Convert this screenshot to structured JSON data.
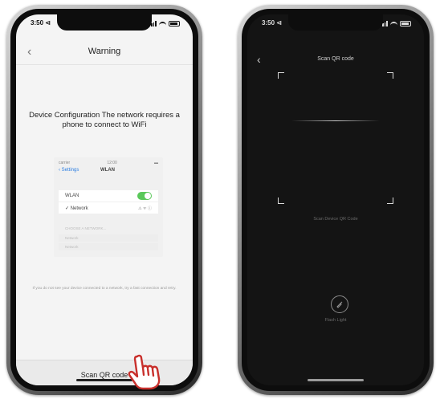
{
  "left_phone": {
    "status": {
      "time": "3:50 ⊲"
    },
    "nav": {
      "back": "‹",
      "title": "Warning"
    },
    "message": "Device Configuration The network requires a phone to connect to WiFi",
    "wifi_settings": {
      "mini_status_left": "carrier",
      "mini_status_time": "12:00",
      "back_label": "‹ Settings",
      "title": "WLAN",
      "wlan_label": "WLAN",
      "network_label": "✓ Network",
      "network_icons": "⚠ ᯤ ⓘ",
      "choose_label": "CHOOSE A NETWORK...",
      "other_1": "Network",
      "other_2": "Network"
    },
    "note": "If you do not see your device connected to a network, try a fast connection and retry.",
    "scan_button": "Scan QR code"
  },
  "right_phone": {
    "status": {
      "time": "3:50 ⊲"
    },
    "back": "‹",
    "title": "Scan QR code",
    "hint": "Scan Device QR Code",
    "flash_label": "Flash Light"
  },
  "colors": {
    "left_screen_bg": "#f4f4f4",
    "right_screen_bg": "#141414",
    "toggle_green": "#5ac85a",
    "hand_red": "#c8302c"
  }
}
